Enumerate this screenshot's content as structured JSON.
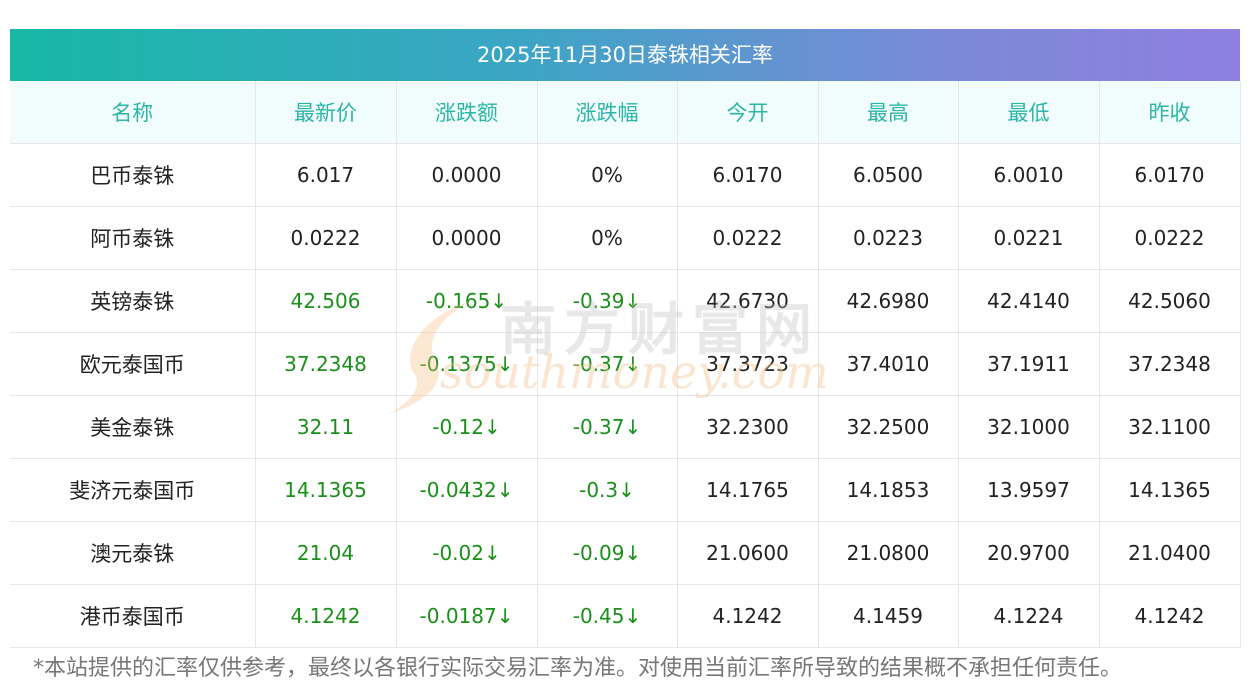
{
  "title": "2025年11月30日泰铢相关汇率",
  "columns": [
    "名称",
    "最新价",
    "涨跌额",
    "涨跌幅",
    "今开",
    "最高",
    "最低",
    "昨收"
  ],
  "rows": [
    {
      "name": "巴币泰铢",
      "latest": "6.017",
      "change": "0.0000",
      "pct": "0%",
      "open": "6.0170",
      "high": "6.0500",
      "low": "6.0010",
      "prev": "6.0170",
      "down": false
    },
    {
      "name": "阿币泰铢",
      "latest": "0.0222",
      "change": "0.0000",
      "pct": "0%",
      "open": "0.0222",
      "high": "0.0223",
      "low": "0.0221",
      "prev": "0.0222",
      "down": false
    },
    {
      "name": "英镑泰铢",
      "latest": "42.506",
      "change": "-0.165↓",
      "pct": "-0.39↓",
      "open": "42.6730",
      "high": "42.6980",
      "low": "42.4140",
      "prev": "42.5060",
      "down": true
    },
    {
      "name": "欧元泰国币",
      "latest": "37.2348",
      "change": "-0.1375↓",
      "pct": "-0.37↓",
      "open": "37.3723",
      "high": "37.4010",
      "low": "37.1911",
      "prev": "37.2348",
      "down": true
    },
    {
      "name": "美金泰铢",
      "latest": "32.11",
      "change": "-0.12↓",
      "pct": "-0.37↓",
      "open": "32.2300",
      "high": "32.2500",
      "low": "32.1000",
      "prev": "32.1100",
      "down": true
    },
    {
      "name": "斐济元泰国币",
      "latest": "14.1365",
      "change": "-0.0432↓",
      "pct": "-0.3↓",
      "open": "14.1765",
      "high": "14.1853",
      "low": "13.9597",
      "prev": "14.1365",
      "down": true
    },
    {
      "name": "澳元泰铢",
      "latest": "21.04",
      "change": "-0.02↓",
      "pct": "-0.09↓",
      "open": "21.0600",
      "high": "21.0800",
      "low": "20.9700",
      "prev": "21.0400",
      "down": true
    },
    {
      "name": "港币泰国币",
      "latest": "4.1242",
      "change": "-0.0187↓",
      "pct": "-0.45↓",
      "open": "4.1242",
      "high": "4.1459",
      "low": "4.1224",
      "prev": "4.1242",
      "down": true
    }
  ],
  "footer": "*本站提供的汇率仅供参考，最终以各银行实际交易汇率为准。对使用当前汇率所导致的结果概不承担任何责任。",
  "watermark": {
    "cn": "南方财富网",
    "en": "southmoney.com"
  },
  "colors": {
    "header_text": "#2db5a6",
    "down": "#1a8f1a",
    "gradient_start": "#17b8a6",
    "gradient_end": "#8f7fdf"
  }
}
